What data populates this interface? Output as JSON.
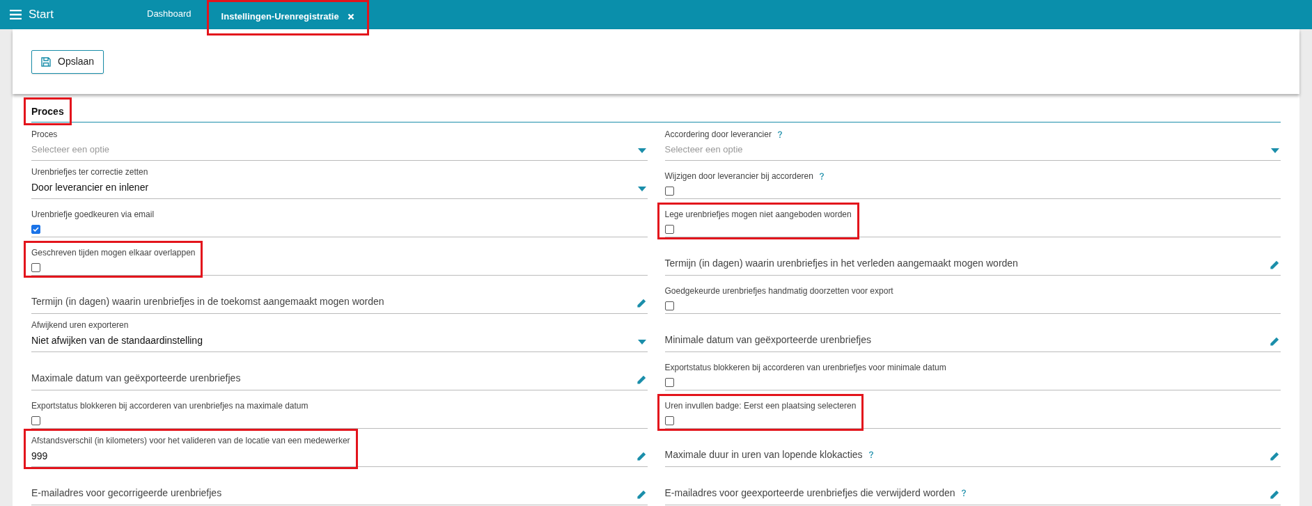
{
  "topbar": {
    "menu_label": "Start",
    "tabs": [
      {
        "label": "Dashboard",
        "selected": false,
        "closable": false,
        "highlighted": false
      },
      {
        "label": "Instellingen-Urenregistratie",
        "selected": true,
        "closable": true,
        "highlighted": true
      }
    ]
  },
  "toolbar": {
    "save_button": "Opslaan"
  },
  "section": {
    "title": "Proces",
    "highlighted": true
  },
  "left_column": [
    {
      "kind": "select",
      "label": "Proces",
      "placeholder": "Selecteer een optie",
      "highlighted": false,
      "help": false
    },
    {
      "kind": "select",
      "label": "Urenbriefjes ter correctie zetten",
      "value": "Door leverancier en inlener",
      "highlighted": false,
      "help": false
    },
    {
      "kind": "checkbox",
      "label": "Urenbriefje goedkeuren via email",
      "checked": true,
      "highlighted": false,
      "help": false
    },
    {
      "kind": "checkbox",
      "label": "Geschreven tijden mogen elkaar overlappen",
      "checked": false,
      "highlighted": true,
      "help": false
    },
    {
      "kind": "edit",
      "label": "Termijn (in dagen) waarin urenbriefjes in de toekomst aangemaakt mogen worden",
      "highlighted": false,
      "help": false
    },
    {
      "kind": "select",
      "label": "Afwijkend uren exporteren",
      "value": "Niet afwijken van de standaardinstelling",
      "highlighted": false,
      "help": false
    },
    {
      "kind": "edit",
      "label": "Maximale datum van geëxporteerde urenbriefjes",
      "highlighted": false,
      "help": false
    },
    {
      "kind": "checkbox",
      "label": "Exportstatus blokkeren bij accorderen van urenbriefjes na maximale datum",
      "checked": false,
      "highlighted": false,
      "help": false
    },
    {
      "kind": "text",
      "label": "Afstandsverschil (in kilometers) voor het valideren van de locatie van een medewerker",
      "value": "999",
      "highlighted": true,
      "help": false
    },
    {
      "kind": "edit",
      "label": "E-mailadres voor gecorrigeerde urenbriefjes",
      "highlighted": false,
      "help": false
    }
  ],
  "right_column": [
    {
      "kind": "select",
      "label": "Accordering door leverancier",
      "placeholder": "Selecteer een optie",
      "highlighted": false,
      "help": true
    },
    {
      "kind": "checkbox",
      "label": "Wijzigen door leverancier bij accorderen",
      "checked": false,
      "highlighted": false,
      "help": true
    },
    {
      "kind": "checkbox",
      "label": "Lege urenbriefjes mogen niet aangeboden worden",
      "checked": false,
      "highlighted": true,
      "help": false
    },
    {
      "kind": "edit",
      "label": "Termijn (in dagen) waarin urenbriefjes in het verleden aangemaakt mogen worden",
      "highlighted": false,
      "help": false
    },
    {
      "kind": "checkbox",
      "label": "Goedgekeurde urenbriefjes handmatig doorzetten voor export",
      "checked": false,
      "highlighted": false,
      "help": false
    },
    {
      "kind": "edit",
      "label": "Minimale datum van geëxporteerde urenbriefjes",
      "highlighted": false,
      "help": false
    },
    {
      "kind": "checkbox",
      "label": "Exportstatus blokkeren bij accorderen van urenbriefjes voor minimale datum",
      "checked": false,
      "highlighted": false,
      "help": false
    },
    {
      "kind": "checkbox",
      "label": "Uren invullen badge: Eerst een plaatsing selecteren",
      "checked": false,
      "highlighted": true,
      "help": false
    },
    {
      "kind": "edit",
      "label": "Maximale duur in uren van lopende klokacties",
      "highlighted": false,
      "help": true
    },
    {
      "kind": "edit",
      "label": "E-mailadres voor geexporteerde urenbriefjes die verwijderd worden",
      "highlighted": false,
      "help": true
    }
  ]
}
